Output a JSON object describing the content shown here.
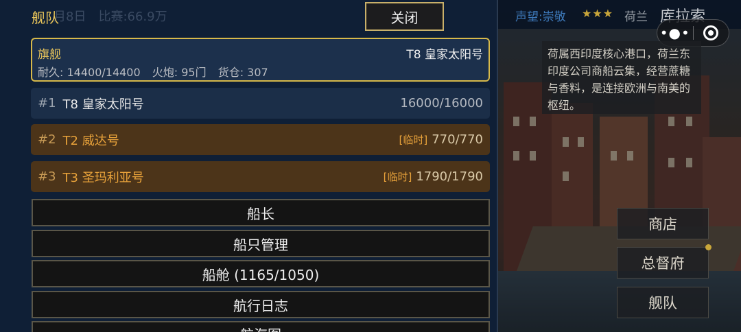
{
  "panel": {
    "title": "舰队",
    "ghost_text": "月8日　比赛:66.9万",
    "close_label": "关闭"
  },
  "flagship": {
    "label": "旗舰",
    "ship": "T8 皇家太阳号",
    "durability": "耐久: 14400/14400",
    "cannons": "火炮: 95门",
    "cargo": "货仓: 307"
  },
  "fleet": [
    {
      "index": "#1",
      "name": "T8 皇家太阳号",
      "tag": "",
      "durability": "16000/16000",
      "temporary": false
    },
    {
      "index": "#2",
      "name": "T2 威达号",
      "tag": "[临时]",
      "durability": "770/770",
      "temporary": true
    },
    {
      "index": "#3",
      "name": "T3 圣玛利亚号",
      "tag": "[临时]",
      "durability": "1790/1790",
      "temporary": true
    }
  ],
  "menu": [
    {
      "label": "船长"
    },
    {
      "label": "船只管理"
    },
    {
      "label": "船舱 (1165/1050)"
    },
    {
      "label": "航行日志"
    },
    {
      "label": "航海图"
    }
  ],
  "header_right": {
    "reputation": "声望:崇敬",
    "stars": "★★★",
    "nation": "荷兰",
    "city": "库拉索"
  },
  "capsule": {
    "more_glyph": "•●•"
  },
  "city_description": "荷属西印度核心港口，荷兰东印度公司商船云集，经营蔗糖与香料，是连接欧洲与南美的枢纽。",
  "side_menu": [
    {
      "label": "商店"
    },
    {
      "label": "总督府"
    },
    {
      "label": "舰队"
    }
  ],
  "colors": {
    "panel_bg": "#0f1f36",
    "gold": "#d7b94a",
    "temporary_text": "#e8a23a",
    "reputation": "#3d78b8"
  }
}
